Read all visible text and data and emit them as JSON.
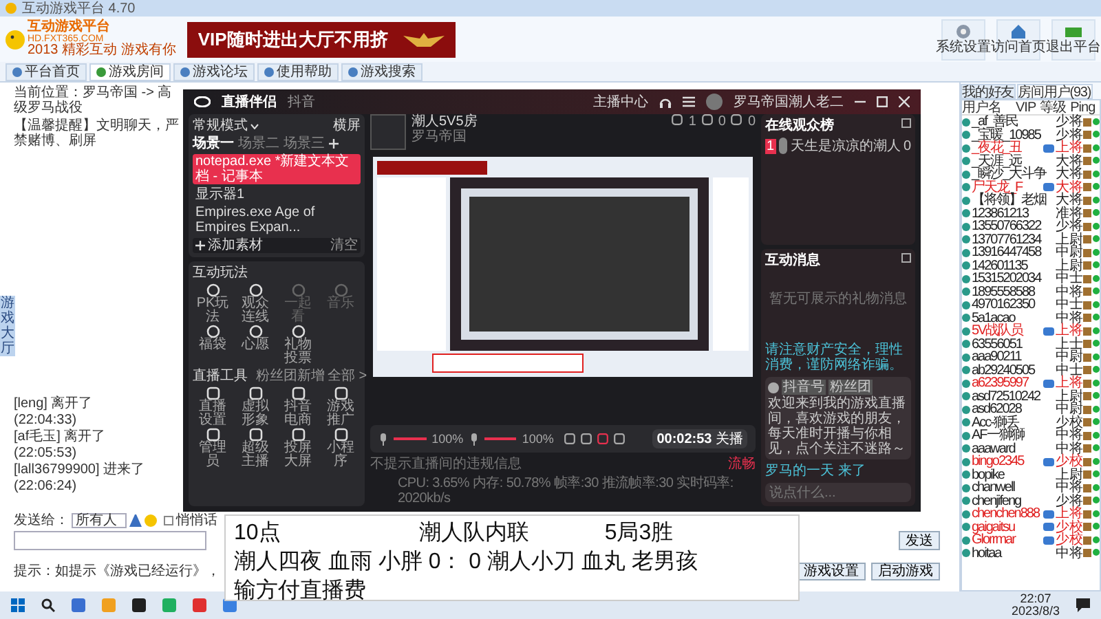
{
  "window": {
    "title": "互动游戏平台 4.70"
  },
  "logo": {
    "name": "互动游戏平台",
    "site": "HD.FXT365.COM",
    "slogan": "2013 精彩互动 游戏有你"
  },
  "banner": {
    "text": "VIP随时进出大厅不用挤"
  },
  "header_buttons": [
    "系统设置",
    "访问首页",
    "退出平台"
  ],
  "tabs": [
    {
      "label": "平台首页",
      "selected": false
    },
    {
      "label": "游戏房间",
      "selected": true
    },
    {
      "label": "游戏论坛",
      "selected": false
    },
    {
      "label": "使用帮助",
      "selected": false
    },
    {
      "label": "游戏搜索",
      "selected": false
    }
  ],
  "breadcrumb": "当前位置：罗马帝国 -> 高级罗马战役",
  "notice": "【温馨提醒】文明聊天，严禁赌博、刷屏",
  "side_tab": "游戏大厅",
  "chat_log": [
    {
      "name": "[leng]",
      "action": "离开了",
      "time": "(22:04:33)"
    },
    {
      "name": "[af毛玉]",
      "action": "离开了",
      "time": "(22:05:53)"
    },
    {
      "name": "[lall36799900]",
      "action": "进来了",
      "time": "(22:06:24)"
    }
  ],
  "send": {
    "label": "发送给：",
    "target": "所有人",
    "private": {
      "label": "悄悄话",
      "checked": false
    },
    "button": "发送"
  },
  "hint": "提示：如提示《游戏已经运行》，",
  "room_buttons": [
    "游戏设置",
    "启动游戏"
  ],
  "user_tabs": [
    {
      "label": "我的好友",
      "selected": false
    },
    {
      "label": "房间用户(93)",
      "selected": true
    }
  ],
  "user_columns": [
    "用户名",
    "VIP",
    "等级",
    "Ping"
  ],
  "users": [
    {
      "name": "_af_善民",
      "level": "少将",
      "vip": false
    },
    {
      "name": "_宝暖_10985",
      "level": "少将",
      "vip": false
    },
    {
      "name": "_夜花_丑",
      "level": "上将",
      "vip": true
    },
    {
      "name": "_天涯_远",
      "level": "大将",
      "vip": false
    },
    {
      "name": "_瞬沙_大斗争",
      "level": "大将",
      "vip": false
    },
    {
      "name": "尸天龙_F",
      "level": "大将",
      "vip": true
    },
    {
      "name": "【将领】老烟",
      "level": "大将",
      "vip": false
    },
    {
      "name": "123861213",
      "level": "准将",
      "vip": false
    },
    {
      "name": "13550766322",
      "level": "少将",
      "vip": false
    },
    {
      "name": "13707761234",
      "level": "上尉",
      "vip": false
    },
    {
      "name": "13916447458",
      "level": "中尉",
      "vip": false
    },
    {
      "name": "142601135",
      "level": "上尉",
      "vip": false
    },
    {
      "name": "15315202034",
      "level": "中士",
      "vip": false
    },
    {
      "name": "1895558588",
      "level": "中将",
      "vip": false
    },
    {
      "name": "4970162350",
      "level": "中士",
      "vip": false
    },
    {
      "name": "5a1acao",
      "level": "中将",
      "vip": false
    },
    {
      "name": "5V战队员",
      "level": "上将",
      "vip": true
    },
    {
      "name": "63556051",
      "level": "上士",
      "vip": false
    },
    {
      "name": "aaa90211",
      "level": "中尉",
      "vip": false
    },
    {
      "name": "ab29240505",
      "level": "中士",
      "vip": false
    },
    {
      "name": "a62395997",
      "level": "上将",
      "vip": true
    },
    {
      "name": "asd72510242",
      "level": "上尉",
      "vip": false
    },
    {
      "name": "asd62028",
      "level": "中尉",
      "vip": false
    },
    {
      "name": "Acc-獅丢",
      "level": "少校",
      "vip": false
    },
    {
      "name": "AF一獅獅",
      "level": "中将",
      "vip": false
    },
    {
      "name": "aaaward",
      "level": "中将",
      "vip": false
    },
    {
      "name": "bingo2345",
      "level": "少校",
      "vip": true
    },
    {
      "name": "bopike",
      "level": "上尉",
      "vip": false
    },
    {
      "name": "chanwell",
      "level": "中将",
      "vip": false
    },
    {
      "name": "chenjifeng",
      "level": "少将",
      "vip": false
    },
    {
      "name": "chenchen888",
      "level": "上将",
      "vip": true
    },
    {
      "name": "gaigaitsu",
      "level": "少校",
      "vip": true
    },
    {
      "name": "Glorrmar",
      "level": "少校",
      "vip": true
    },
    {
      "name": "hoitaa",
      "level": "中将",
      "vip": false
    }
  ],
  "stream": {
    "app": "直播伴侣",
    "platform": "抖音",
    "center": "主播中心",
    "user": "罗马帝国潮人老二",
    "mode": "常规模式",
    "orientation": "横屏",
    "scenes": [
      {
        "label": "场景一",
        "selected": true
      },
      {
        "label": "场景二",
        "selected": false
      },
      {
        "label": "场景三",
        "selected": false
      }
    ],
    "sources": [
      {
        "label": "notepad.exe *新建文本文档 - 记事本",
        "selected": true
      },
      {
        "label": "显示器1",
        "selected": false
      },
      {
        "label": "Empires.exe Age of Empires Expan...",
        "selected": false
      }
    ],
    "add_source": "添加素材",
    "clear": "清空",
    "play_title": "互动玩法",
    "plays": [
      {
        "label": "PK玩法",
        "disabled": false
      },
      {
        "label": "观众连线",
        "disabled": false
      },
      {
        "label": "一起看",
        "disabled": true
      },
      {
        "label": "音乐",
        "disabled": true
      },
      {
        "label": "福袋",
        "disabled": false
      },
      {
        "label": "心愿",
        "disabled": false
      },
      {
        "label": "礼物投票",
        "disabled": false
      }
    ],
    "tools_title": "直播工具",
    "tools_link": "粉丝团新增",
    "tools_all": "全部 >",
    "tools": [
      "直播设置",
      "虚拟形象",
      "抖音电商",
      "游戏推广",
      "管理员",
      "超级主播",
      "投屏大屏",
      "小程序"
    ],
    "room_title": "潮人5V5房",
    "room_category": "罗马帝国",
    "stats": [
      "1",
      "0",
      "0"
    ],
    "mic": {
      "level": 1,
      "reading": "100%"
    },
    "speaker": {
      "level": 1,
      "reading": "100%"
    },
    "timer": "00:02:53",
    "end_button": "关播",
    "tip": "不提示直播间的违规信息",
    "status": "CPU: 3.65%  内存: 50.78%  帧率:30  推流帧率:30  实时码率: 2020kb/s",
    "quality": "流畅",
    "viewers_title": "在线观众榜",
    "viewers": [
      {
        "rank": "1",
        "name": "天生是凉凉的潮人",
        "score": "0"
      }
    ],
    "messages_title": "互动消息",
    "empty_gifts": "暂无可展示的礼物消息",
    "notice": "请注意财产安全，理性消费，谨防网络诈骗。",
    "message": {
      "badges": [
        "抖音号",
        "粉丝团"
      ],
      "text": "欢迎来到我的游戏直播间，喜欢游戏的朋友，每天准时开播与你相见，点个关注不迷路～"
    },
    "joined": "罗马的一天 来了",
    "input_placeholder": "说点什么..."
  },
  "overlay": {
    "lines": [
      [
        "10点",
        "潮人队内联",
        "5局3胜"
      ],
      [
        "潮人四夜 血雨 小胖 0： 0 潮人小刀 血丸 老男孩"
      ],
      [
        "输方付直播费"
      ]
    ]
  },
  "taskbar": {
    "time": "22:07",
    "date": "2023/8/3"
  }
}
